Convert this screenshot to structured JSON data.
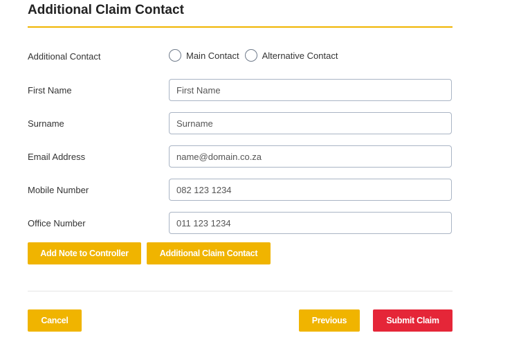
{
  "page": {
    "title": "Additional Claim Contact"
  },
  "colors": {
    "accent": "#f0b400",
    "danger": "#e52638"
  },
  "form": {
    "additional_contact": {
      "label": "Additional Contact",
      "options": [
        "Main Contact",
        "Alternative Contact"
      ]
    },
    "first_name": {
      "label": "First Name",
      "placeholder": "First Name",
      "value": ""
    },
    "surname": {
      "label": "Surname",
      "placeholder": "Surname",
      "value": ""
    },
    "email": {
      "label": "Email Address",
      "placeholder": "name@domain.co.za",
      "value": ""
    },
    "mobile": {
      "label": "Mobile Number",
      "placeholder": "082 123 1234",
      "value": ""
    },
    "office": {
      "label": "Office Number",
      "placeholder": "011 123 1234",
      "value": ""
    }
  },
  "actions": {
    "add_note": "Add Note to Controller",
    "additional_claim_contact": "Additional Claim Contact"
  },
  "footer": {
    "cancel": "Cancel",
    "previous": "Previous",
    "submit": "Submit Claim"
  }
}
